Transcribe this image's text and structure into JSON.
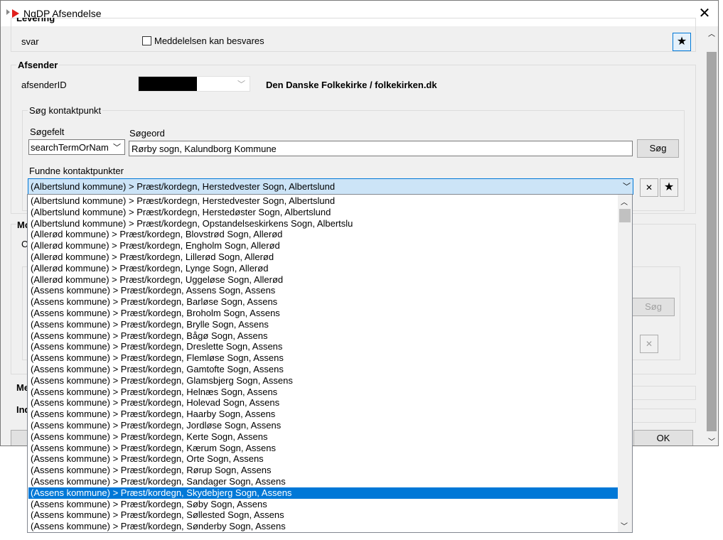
{
  "window": {
    "title": "NgDP Afsendelse",
    "close_glyph": "✕"
  },
  "svar": {
    "partial_group_label": "Levering",
    "label": "svar",
    "checkbox_label": "Meddelelsen kan besvares"
  },
  "afsender": {
    "group_label": "Afsender",
    "id_label": "afsenderID",
    "name": "Den Danske Folkekirke / folkekirken.dk"
  },
  "search": {
    "group_label": "Søg kontaktpunkt",
    "field_label": "Søgefelt",
    "field_value": "searchTermOrNam",
    "term_label": "Søgeord",
    "term_value": "Rørby sogn, Kalundborg Kommune",
    "search_button": "Søg",
    "found_label": "Fundne kontaktpunkter",
    "selected_value": "(Albertslund kommune) > Præst/kordegn, Herstedvester Sogn, Albertslund",
    "clear_glyph": "✕",
    "star_glyph": "★"
  },
  "background": {
    "mo": "Mo",
    "c": "C",
    "me": "Me",
    "ind": "Ind",
    "search_button": "Søg",
    "ok_button": "OK",
    "clear_glyph": "✕"
  },
  "dropdown_items": [
    "(Albertslund kommune) > Præst/kordegn, Herstedvester Sogn, Albertslund",
    "(Albertslund kommune) > Præst/kordegn, Herstedøster Sogn, Albertslund",
    "(Albertslund kommune) > Præst/kordegn, Opstandelseskirkens Sogn, Albertslu",
    "(Allerød kommune) > Præst/kordegn, Blovstrød Sogn, Allerød",
    "(Allerød kommune) > Præst/kordegn, Engholm Sogn, Allerød",
    "(Allerød kommune) > Præst/kordegn, Lillerød Sogn, Allerød",
    "(Allerød kommune) > Præst/kordegn, Lynge Sogn, Allerød",
    "(Allerød kommune) > Præst/kordegn, Uggeløse Sogn, Allerød",
    "(Assens kommune) > Præst/kordegn, Assens Sogn, Assens",
    "(Assens kommune) > Præst/kordegn, Barløse Sogn, Assens",
    "(Assens kommune) > Præst/kordegn, Broholm Sogn, Assens",
    "(Assens kommune) > Præst/kordegn, Brylle Sogn, Assens",
    "(Assens kommune) > Præst/kordegn, Bågø Sogn, Assens",
    "(Assens kommune) > Præst/kordegn, Dreslette Sogn, Assens",
    "(Assens kommune) > Præst/kordegn, Flemløse Sogn, Assens",
    "(Assens kommune) > Præst/kordegn, Gamtofte Sogn, Assens",
    "(Assens kommune) > Præst/kordegn, Glamsbjerg Sogn, Assens",
    "(Assens kommune) > Præst/kordegn, Helnæs Sogn, Assens",
    "(Assens kommune) > Præst/kordegn, Holevad Sogn, Assens",
    "(Assens kommune) > Præst/kordegn, Haarby Sogn, Assens",
    "(Assens kommune) > Præst/kordegn, Jordløse Sogn, Assens",
    "(Assens kommune) > Præst/kordegn, Kerte Sogn, Assens",
    "(Assens kommune) > Præst/kordegn, Kærum Sogn, Assens",
    "(Assens kommune) > Præst/kordegn, Orte Sogn, Assens",
    "(Assens kommune) > Præst/kordegn, Rørup Sogn, Assens",
    "(Assens kommune) > Præst/kordegn, Sandager Sogn, Assens",
    "(Assens kommune) > Præst/kordegn, Skydebjerg Sogn, Assens",
    "(Assens kommune) > Præst/kordegn, Søby Sogn, Assens",
    "(Assens kommune) > Præst/kordegn, Søllested Sogn, Assens",
    "(Assens kommune) > Præst/kordegn, Sønderby Sogn, Assens"
  ],
  "selected_index": 26,
  "colors": {
    "selection": "#0078d7",
    "close_icon_red": "#e0201c"
  }
}
